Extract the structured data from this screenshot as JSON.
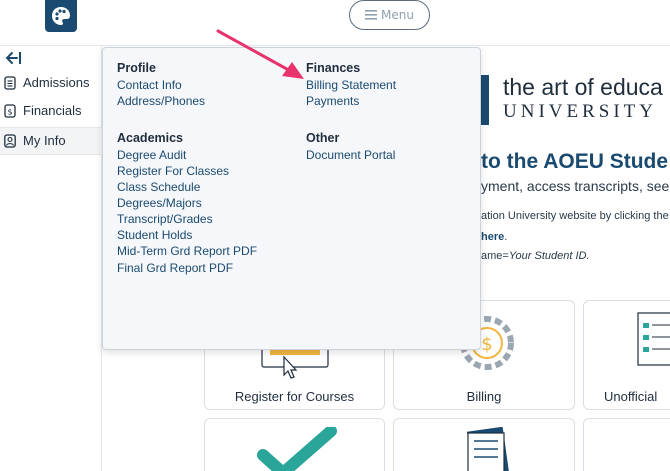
{
  "header": {
    "logo_icon": "palette-icon",
    "menu_label": "Menu"
  },
  "sidebar": {
    "collapse_icon": "collapse-left-icon",
    "items": [
      {
        "label": "Admissions",
        "icon": "document-icon"
      },
      {
        "label": "Financials",
        "icon": "dollar-document-icon"
      },
      {
        "label": "My Info",
        "icon": "user-icon"
      }
    ]
  },
  "dropdown": {
    "profile": {
      "heading": "Profile",
      "links": [
        "Contact Info",
        "Address/Phones"
      ]
    },
    "finances": {
      "heading": "Finances",
      "links": [
        "Billing Statement",
        "Payments"
      ]
    },
    "academics": {
      "heading": "Academics",
      "links": [
        "Degree Audit",
        "Register For Classes",
        "Class Schedule",
        "Degrees/Majors",
        "Transcript/Grades",
        "Student Holds",
        "Mid-Term Grd Report PDF",
        "Final Grd Report PDF"
      ]
    },
    "other": {
      "heading": "Other",
      "links": [
        "Document Portal"
      ]
    }
  },
  "main": {
    "brand_line1": "the art of educa",
    "brand_line2": "UNIVERSITY",
    "welcome": "to the AOEU Stude",
    "tagline": "yment, access transcripts, see you",
    "note1": "ation University website by clicking the l",
    "note2": "here",
    "note2_suffix": ".",
    "note3_prefix": "ame=",
    "note3_italic": "Your Student ID.",
    "cards": [
      {
        "label": "Register for Courses",
        "icon": "register-icon"
      },
      {
        "label": "Billing",
        "icon": "billing-gear-icon"
      },
      {
        "label": "Unofficial",
        "icon": "transcript-icon"
      },
      {
        "label": "",
        "icon": "checkmark-icon"
      },
      {
        "label": "",
        "icon": "documents-icon"
      },
      {
        "label": "",
        "icon": "blank-card"
      }
    ]
  },
  "colors": {
    "brand_navy": "#1b4a70",
    "annotation_arrow": "#e8336d",
    "dropdown_bg": "#f5f7fa",
    "teal": "#2aa59a",
    "gold": "#f3b63f"
  }
}
